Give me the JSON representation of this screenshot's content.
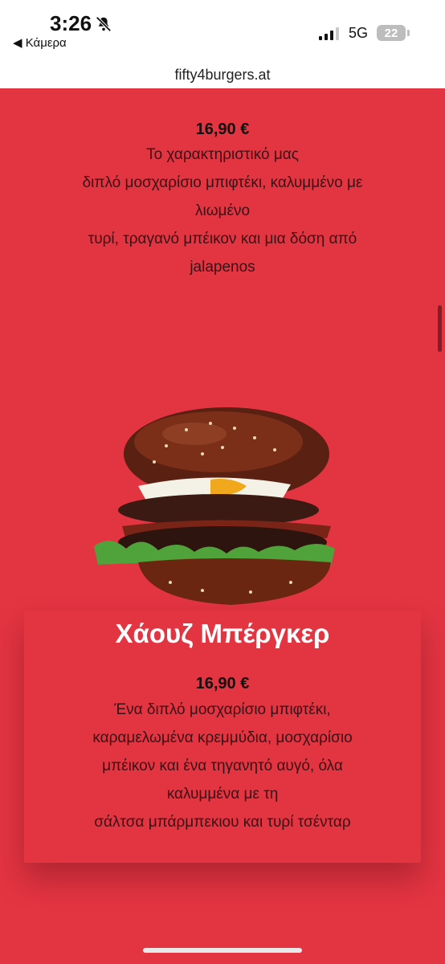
{
  "status": {
    "time": "3:26",
    "back_app": "◀ Κάμερα",
    "network": "5G",
    "battery": "22",
    "icons": [
      "bell-slash-icon",
      "signal-icon"
    ]
  },
  "browser": {
    "url": "fifty4burgers.at"
  },
  "items": [
    {
      "price": "16,90 €",
      "description_lines": [
        "Το χαρακτηριστικό μας",
        "διπλό μοσχαρίσιο μπιφτέκι, καλυμμένο με",
        "λιωμένο",
        "τυρί, τραγανό μπέικον και μια δόση από",
        "jalapenos"
      ]
    },
    {
      "title": "Χάουζ Μπέργκερ",
      "price": "16,90 €",
      "description_lines": [
        "Ένα διπλό μοσχαρίσιο μπιφτέκι,",
        "καραμελωμένα κρεμμύδια, μοσχαρίσιο",
        "μπέικον και ένα τηγανητό αυγό, όλα",
        "καλυμμένα με τη",
        "σάλτσα μπάρμπεκιου και τυρί τσένταρ"
      ]
    }
  ],
  "colors": {
    "page_bg": "#e33442",
    "title": "#ffffff",
    "text": "#3a1216"
  }
}
